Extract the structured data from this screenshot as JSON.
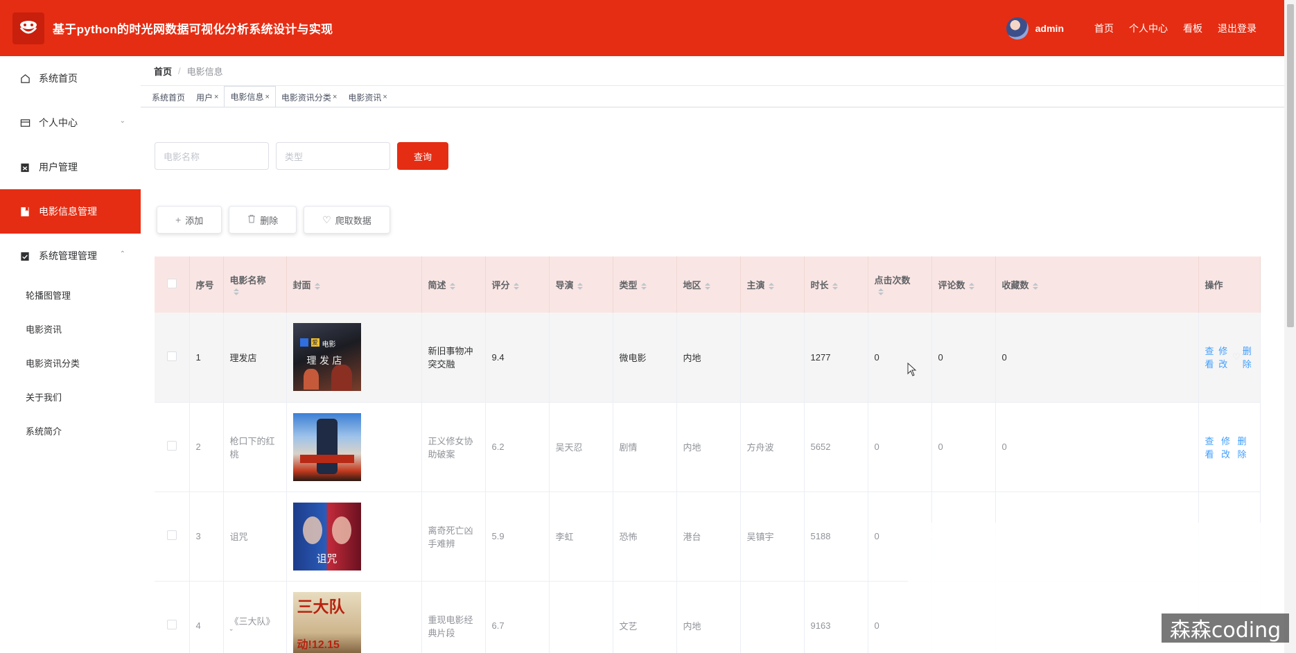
{
  "header": {
    "title": "基于python的时光网数据可视化分析系统设计与实现",
    "username": "admin",
    "nav": [
      "首页",
      "个人中心",
      "看板",
      "退出登录"
    ]
  },
  "sidebar": {
    "items": [
      {
        "label": "系统首页",
        "icon": "home-icon"
      },
      {
        "label": "个人中心",
        "icon": "id-card-icon"
      },
      {
        "label": "用户管理",
        "icon": "clipboard-icon"
      },
      {
        "label": "电影信息管理",
        "icon": "bookmark-icon"
      },
      {
        "label": "系统管理管理",
        "icon": "clipboard-check-icon"
      }
    ],
    "sub_items": [
      "轮播图管理",
      "电影资讯",
      "电影资讯分类",
      "关于我们",
      "系统简介"
    ]
  },
  "breadcrumb": {
    "home": "首页",
    "current": "电影信息"
  },
  "tabs": [
    "系统首页",
    "用户",
    "电影信息",
    "电影资讯分类",
    "电影资讯"
  ],
  "search": {
    "name_placeholder": "电影名称",
    "type_placeholder": "类型",
    "button": "查询"
  },
  "actions": {
    "add": "添加",
    "delete": "删除",
    "crawl": "爬取数据"
  },
  "table": {
    "headers": [
      "序号",
      "电影名称",
      "封面",
      "简述",
      "评分",
      "导演",
      "类型",
      "地区",
      "主演",
      "时长",
      "点击次数",
      "评论数",
      "收藏数",
      "操作"
    ],
    "rows": [
      {
        "no": "1",
        "name": "理发店",
        "desc": "新旧事物冲突交融",
        "score": "9.4",
        "director": "",
        "type": "微电影",
        "region": "内地",
        "actor": "",
        "duration": "1277",
        "clicks": "0",
        "comments": "0",
        "favorites": "0"
      },
      {
        "no": "2",
        "name": "枪口下的红桃",
        "desc": "正义修女协助破案",
        "score": "6.2",
        "director": "吴天忍",
        "type": "剧情",
        "region": "内地",
        "actor": "方舟波",
        "duration": "5652",
        "clicks": "0",
        "comments": "0",
        "favorites": "0"
      },
      {
        "no": "3",
        "name": "诅咒",
        "desc": "离奇死亡凶手难辨",
        "score": "5.9",
        "director": "李虹",
        "type": "恐怖",
        "region": "港台",
        "actor": "吴镇宇",
        "duration": "5188",
        "clicks": "0",
        "comments": "",
        "favorites": ""
      },
      {
        "no": "4",
        "name": "《三大队》 ˇ",
        "desc": "重现电影经典片段",
        "score": "6.7",
        "director": "",
        "type": "文艺",
        "region": "内地",
        "actor": "",
        "duration": "9163",
        "clicks": "0",
        "comments": "",
        "favorites": ""
      }
    ],
    "ops": {
      "view": "查看",
      "edit": "修改",
      "delete": "删除"
    }
  },
  "covers": {
    "c1": {
      "line1": "爱",
      "line2": "电影",
      "line3": "理 发 店"
    },
    "c3": "诅咒",
    "c4": {
      "top": "三大队",
      "bottom": "动!12.15"
    }
  },
  "watermark": "森森coding",
  "colors": {
    "brand": "#e52d13",
    "link": "#409eff",
    "header_row": "#f9e6e4"
  }
}
